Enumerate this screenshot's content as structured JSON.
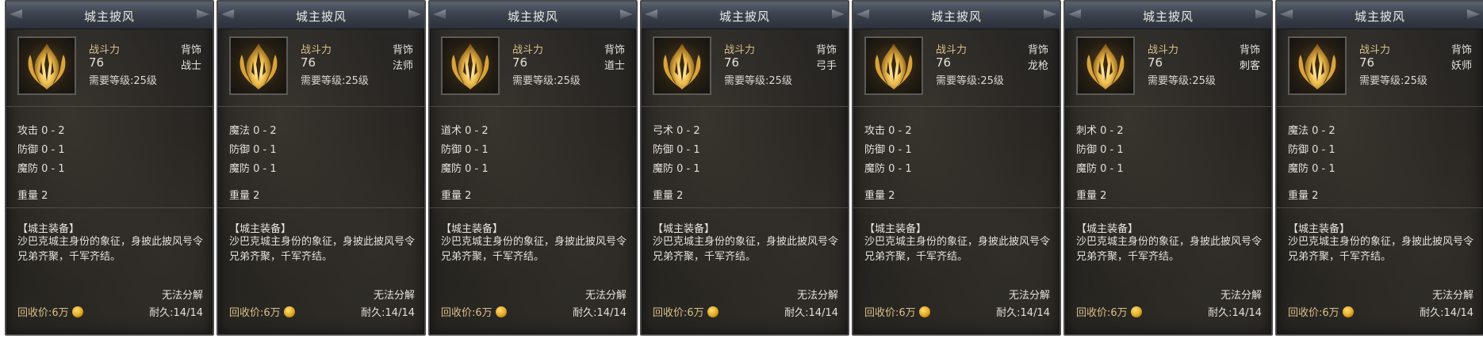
{
  "common": {
    "title": "城主披风",
    "power_label": "战斗力",
    "power_value": "76",
    "required_level": "需要等级:25级",
    "slot": "背饰",
    "defense": "防御 0 - 1",
    "magic_defense": "魔防 0 - 1",
    "weight": "重量 2",
    "tag": "【城主装备】",
    "description": "沙巴克城主身份的象征，身披此披风号令兄弟齐聚，千军齐结。",
    "no_decompose": "无法分解",
    "recycle_price": "回收价:6万",
    "durability": "耐久:14/14"
  },
  "cards": [
    {
      "class_name": "战士",
      "attack_stat": "攻击 0 - 2"
    },
    {
      "class_name": "法师",
      "attack_stat": "魔法 0 - 2"
    },
    {
      "class_name": "道士",
      "attack_stat": "道术 0 - 2"
    },
    {
      "class_name": "弓手",
      "attack_stat": "弓术 0 - 2"
    },
    {
      "class_name": "龙枪",
      "attack_stat": "攻击 0 - 2"
    },
    {
      "class_name": "刺客",
      "attack_stat": "刺术 0 - 2"
    },
    {
      "class_name": "妖师",
      "attack_stat": "魔法 0 - 2"
    }
  ],
  "icons": {
    "item": "golden-flame-cloak-icon",
    "coin": "gold-coin-icon"
  }
}
